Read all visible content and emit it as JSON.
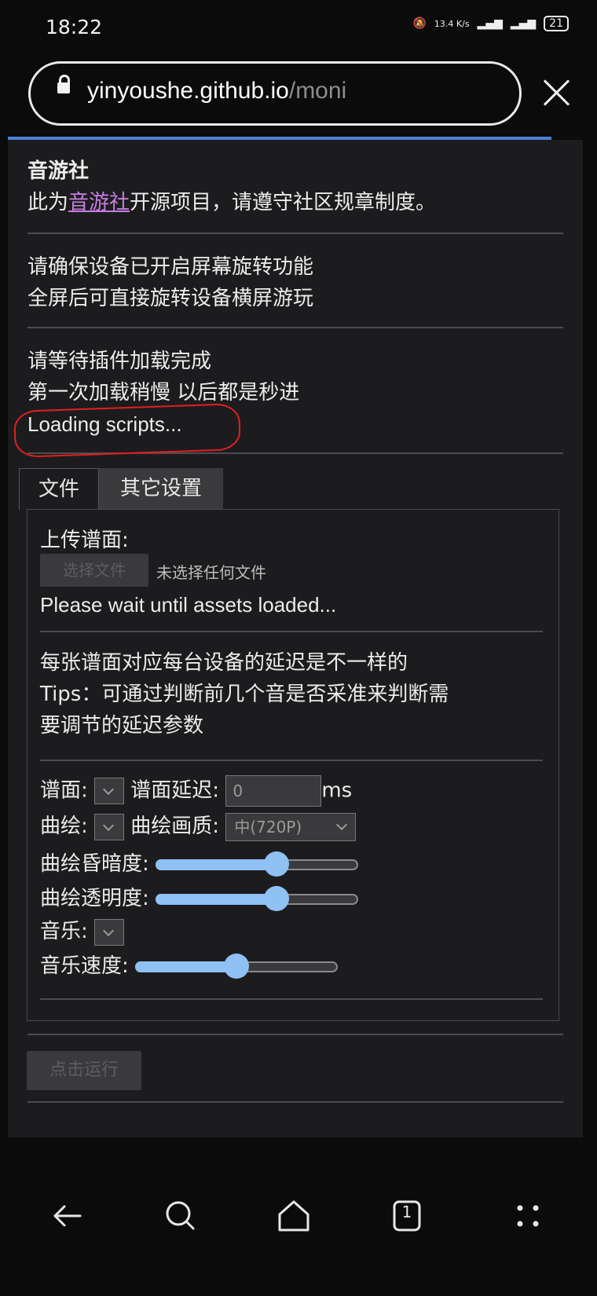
{
  "status_bar": {
    "time": "18:22",
    "net_speed": "13.4 K/s",
    "battery": "21"
  },
  "browser": {
    "url_host": "yinyoushe.github.io",
    "url_path": "/moni"
  },
  "intro": {
    "title": "音游社",
    "line_prefix": "此为",
    "link": "音游社",
    "line_suffix": "开源项目，请遵守社区规章制度。"
  },
  "rotate_note": {
    "line1": "请确保设备已开启屏幕旋转功能",
    "line2": "全屏后可直接旋转设备横屏游玩"
  },
  "loading": {
    "line1": "请等待插件加载完成",
    "line2": "第一次加载稍慢 以后都是秒进",
    "status": "Loading scripts..."
  },
  "tabs": [
    {
      "label": "文件"
    },
    {
      "label": "其它设置"
    }
  ],
  "upload": {
    "label": "上传谱面:",
    "choose_button": "选择文件",
    "no_file": "未选择任何文件",
    "wait": "Please wait until assets loaded..."
  },
  "tips": {
    "line1": "每张谱面对应每台设备的延迟是不一样的",
    "line2": "Tips：可通过判断前几个音是否采准来判断需",
    "line3": "要调节的延迟参数"
  },
  "settings": {
    "chart_label": "谱面:",
    "delay_label": "谱面延迟:",
    "delay_value": "0",
    "delay_unit": "ms",
    "illust_label": "曲绘:",
    "quality_label": "曲绘画质:",
    "quality_value": "中(720P)",
    "dim_label": "曲绘昏暗度:",
    "dim_level": 0.6,
    "opacity_label": "曲绘透明度:",
    "opacity_level": 0.6,
    "music_label": "音乐:",
    "speed_label": "音乐速度:",
    "speed_level": 0.5
  },
  "run_button": "点击运行",
  "nav_icons": [
    "back-icon",
    "search-icon",
    "home-icon",
    "tabs-icon",
    "menu-icon"
  ],
  "nav_tab_count": "1",
  "colors": {
    "accent_slider": "#8fc1f5",
    "link": "#c77fe0",
    "progress": "#4f80d8",
    "annotation": "#e02020"
  }
}
